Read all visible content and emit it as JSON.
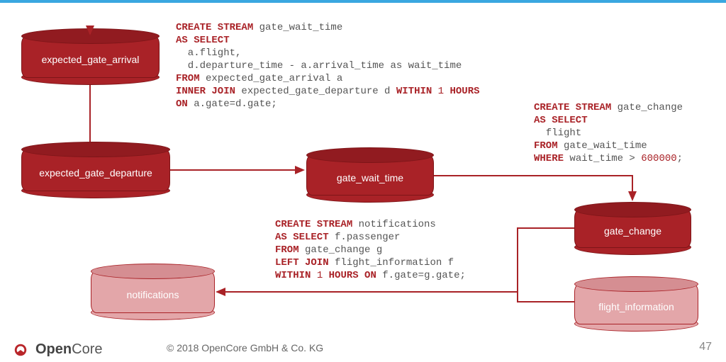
{
  "cylinders": {
    "expected_gate_arrival": "expected_gate_arrival",
    "expected_gate_departure": "expected_gate_departure",
    "gate_wait_time": "gate_wait_time",
    "gate_change": "gate_change",
    "notifications": "notifications",
    "flight_information": "flight_information"
  },
  "sql1": {
    "l1a": "CREATE STREAM",
    "l1b": " gate_wait_time",
    "l2": "AS SELECT",
    "l3": "  a.flight,",
    "l4": "  d.departure_time - a.arrival_time as wait_time",
    "l5a": "FROM",
    "l5b": " expected_gate_arrival a",
    "l6a": "INNER JOIN",
    "l6b": " expected_gate_departure d ",
    "l6c": "WITHIN",
    "l6d": " 1 ",
    "l6e": "HOURS",
    "l7a": "ON",
    "l7b": " a.gate=d.gate;"
  },
  "sql2": {
    "l1a": "CREATE STREAM",
    "l1b": " gate_change",
    "l2": "AS SELECT",
    "l3": "  flight",
    "l4a": "FROM",
    "l4b": " gate_wait_time",
    "l5a": "WHERE",
    "l5b": " wait_time > ",
    "l5c": "600000",
    "l5d": ";"
  },
  "sql3": {
    "l1a": "CREATE STREAM",
    "l1b": " notifications",
    "l2a": "AS SELECT",
    "l2b": " f.passenger",
    "l3a": "FROM",
    "l3b": " gate_change g",
    "l4a": "LEFT JOIN",
    "l4b": " flight_information f",
    "l5a": "WITHIN",
    "l5b": " 1 ",
    "l5c": "HOURS ON",
    "l5d": " f.gate=g.gate;"
  },
  "footer": {
    "brand_open": "Open",
    "brand_core": "Core",
    "copyright": "© 2018 OpenCore GmbH & Co. KG",
    "page": "47"
  }
}
